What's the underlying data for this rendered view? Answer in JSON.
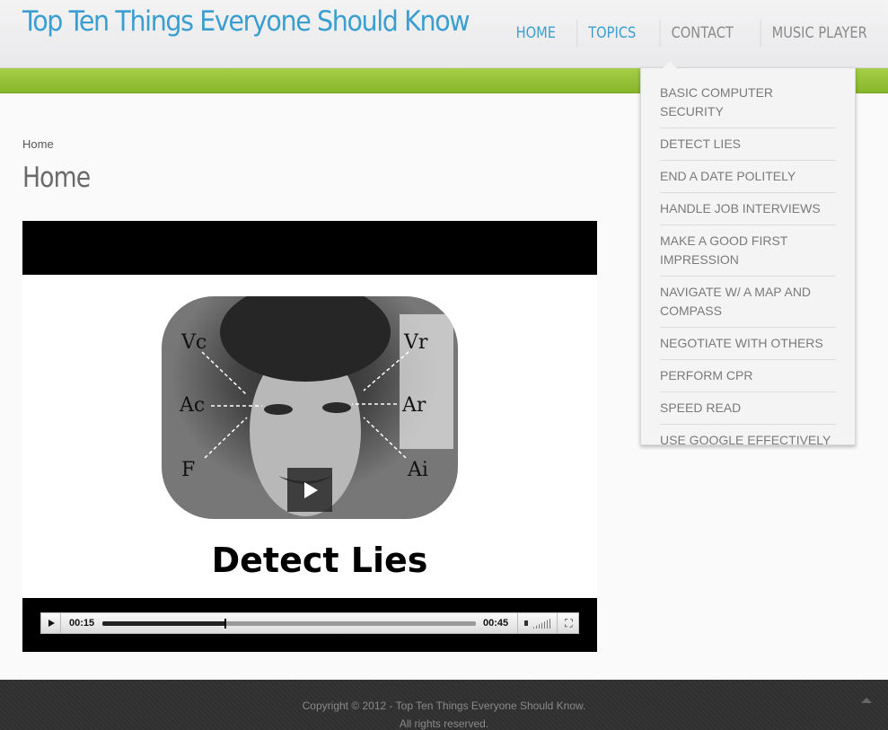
{
  "header": {
    "site_title": "Top Ten Things Everyone Should Know",
    "nav": [
      {
        "label": "HOME"
      },
      {
        "label": "TOPICS"
      },
      {
        "label": "CONTACT"
      },
      {
        "label": "MUSIC PLAYER"
      }
    ]
  },
  "topics_menu": [
    "BASIC COMPUTER SECURITY",
    "DETECT LIES",
    "END A DATE POLITELY",
    "HANDLE JOB INTERVIEWS",
    "MAKE A GOOD FIRST IMPRESSION",
    "NAVIGATE W/ A MAP AND COMPASS",
    "NEGOTIATE WITH OTHERS",
    "PERFORM CPR",
    "SPEED READ",
    "USE GOOGLE EFFECTIVELY"
  ],
  "main": {
    "breadcrumb": "Home",
    "page_title": "Home"
  },
  "video": {
    "caption": "Detect Lies",
    "labels": [
      "Vc",
      "Vr",
      "Ac",
      "Ar",
      "F",
      "Ai"
    ],
    "current_time": "00:15",
    "duration": "00:45",
    "progress_fraction": 0.33
  },
  "footer": {
    "line1": "Copyright © 2012 - Top Ten Things Everyone Should Know.",
    "line2": "All rights reserved."
  },
  "colors": {
    "accent_blue": "#3a9fd0",
    "green_bar": "#96c23a",
    "footer_bg": "#333333"
  }
}
